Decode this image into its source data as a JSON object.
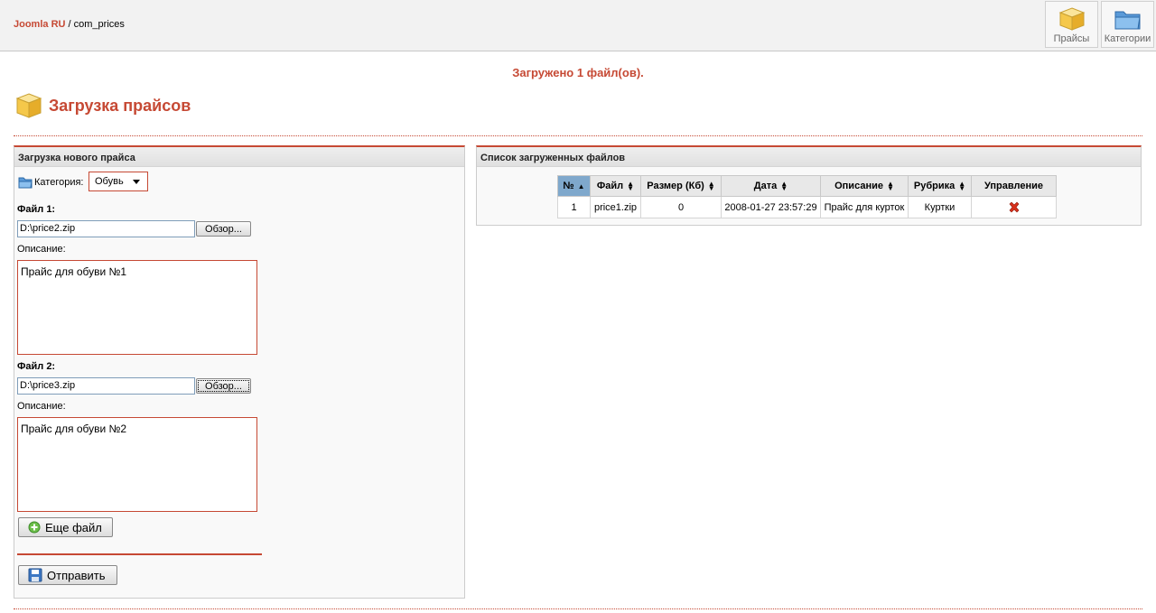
{
  "breadcrumb": {
    "site": "Joomla RU",
    "separator": " / ",
    "component": "com_prices"
  },
  "toolbar": {
    "prices_label": "Прайсы",
    "categories_label": "Категории"
  },
  "message": "Загружено 1 файл(ов).",
  "page_title": "Загрузка прайсов",
  "upload_panel": {
    "heading": "Загрузка нового прайса",
    "category_label": "Категория:",
    "category_value": "Обувь",
    "file1_label": "Файл 1:",
    "file1_value": "D:\\price2.zip",
    "browse_label": "Обзор...",
    "desc_label": "Описание:",
    "desc1_value": "Прайс для обуви №1",
    "file2_label": "Файл 2:",
    "file2_value": "D:\\price3.zip",
    "desc2_value": "Прайс для обуви №2",
    "more_button": "Еще файл",
    "submit_button": "Отправить"
  },
  "files_panel": {
    "heading": "Список загруженных файлов",
    "columns": [
      "№",
      "Файл",
      "Размер (Кб)",
      "Дата",
      "Описание",
      "Рубрика",
      "Управление"
    ],
    "rows": [
      {
        "num": "1",
        "file": "price1.zip",
        "size": "0",
        "date": "2008-01-27 23:57:29",
        "description": "Прайс для курток",
        "category": "Куртки"
      }
    ]
  },
  "colors": {
    "accent": "#c64934",
    "sorted_header": "#7fa8cc"
  }
}
